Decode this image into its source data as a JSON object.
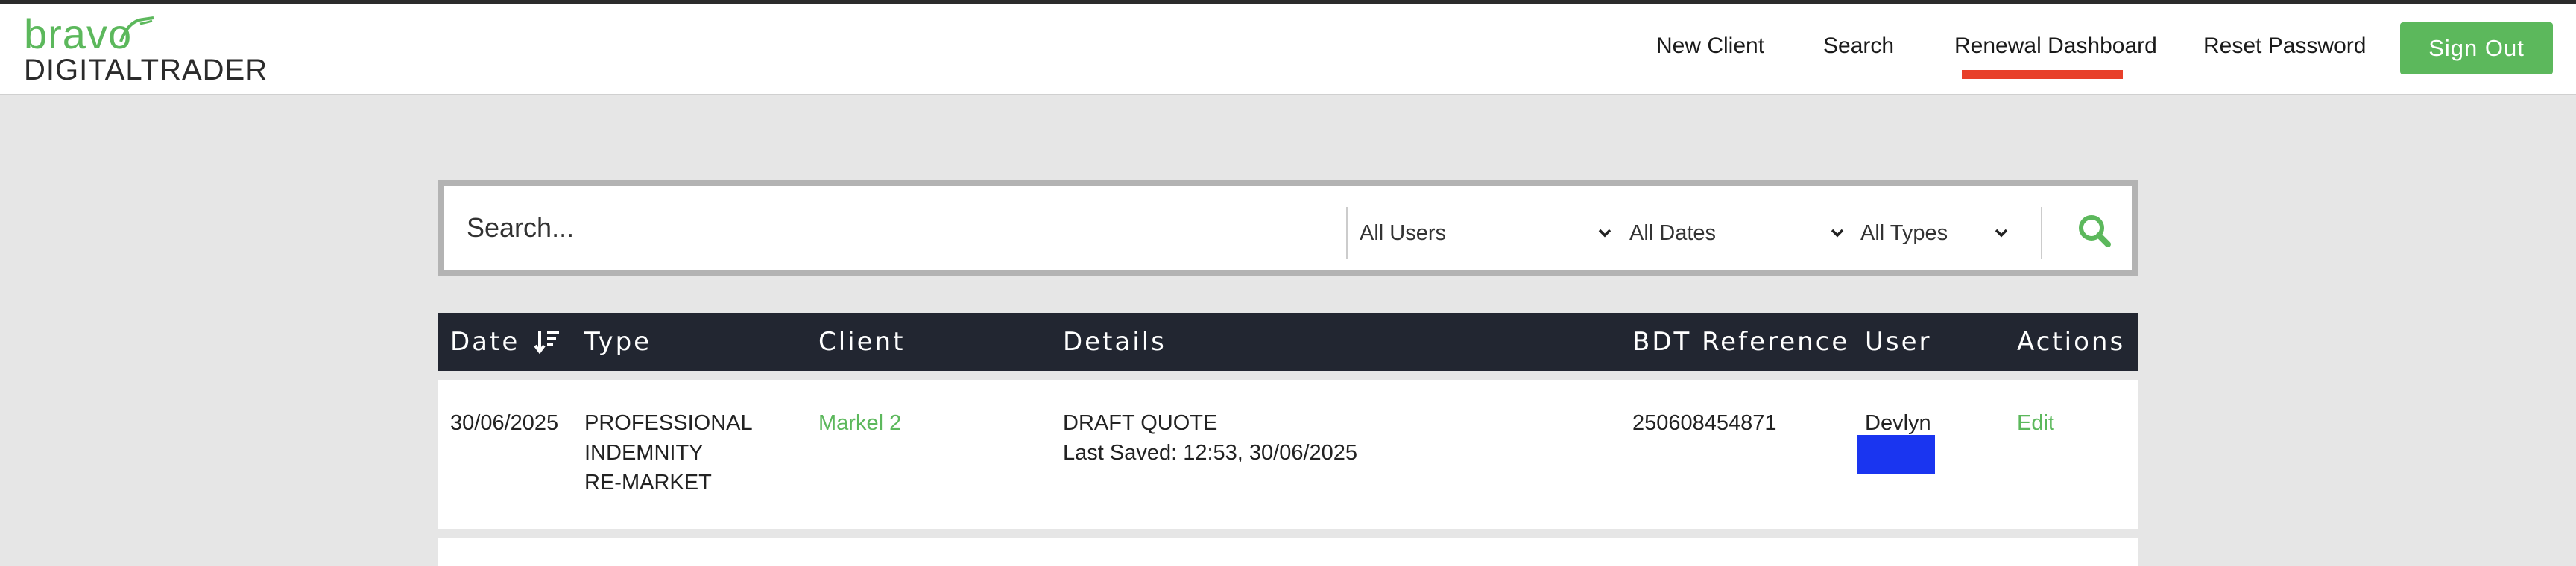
{
  "logo": {
    "top": "bravo",
    "bottom": "DIGITALTRADER"
  },
  "nav": {
    "items": [
      {
        "label": "New Client"
      },
      {
        "label": "Search"
      },
      {
        "label": "Renewal Dashboard",
        "active": true
      },
      {
        "label": "Reset Password"
      }
    ],
    "sign_out": "Sign Out"
  },
  "search": {
    "placeholder": "Search...",
    "users": "All Users",
    "dates": "All Dates",
    "types": "All Types",
    "icon": "search-icon"
  },
  "table": {
    "columns": [
      "Date",
      "Type",
      "Client",
      "Details",
      "BDT Reference",
      "User",
      "Actions"
    ],
    "sort_icon": "sort-descending-icon",
    "rows": [
      {
        "date": "30/06/2025",
        "type": [
          "PROFESSIONAL",
          "INDEMNITY",
          "RE-MARKET"
        ],
        "client": "Markel 2",
        "details_title": "DRAFT QUOTE",
        "details_saved": "Last Saved: 12:53, 30/06/2025",
        "reference": "250608454871",
        "user": "Devlyn",
        "action": "Edit"
      }
    ]
  },
  "colors": {
    "accent": "#5cb85c",
    "active_underline": "#e8402a",
    "table_header": "#222631",
    "user_badge": "#1a35f0",
    "page_bg": "#e6e6e6"
  }
}
